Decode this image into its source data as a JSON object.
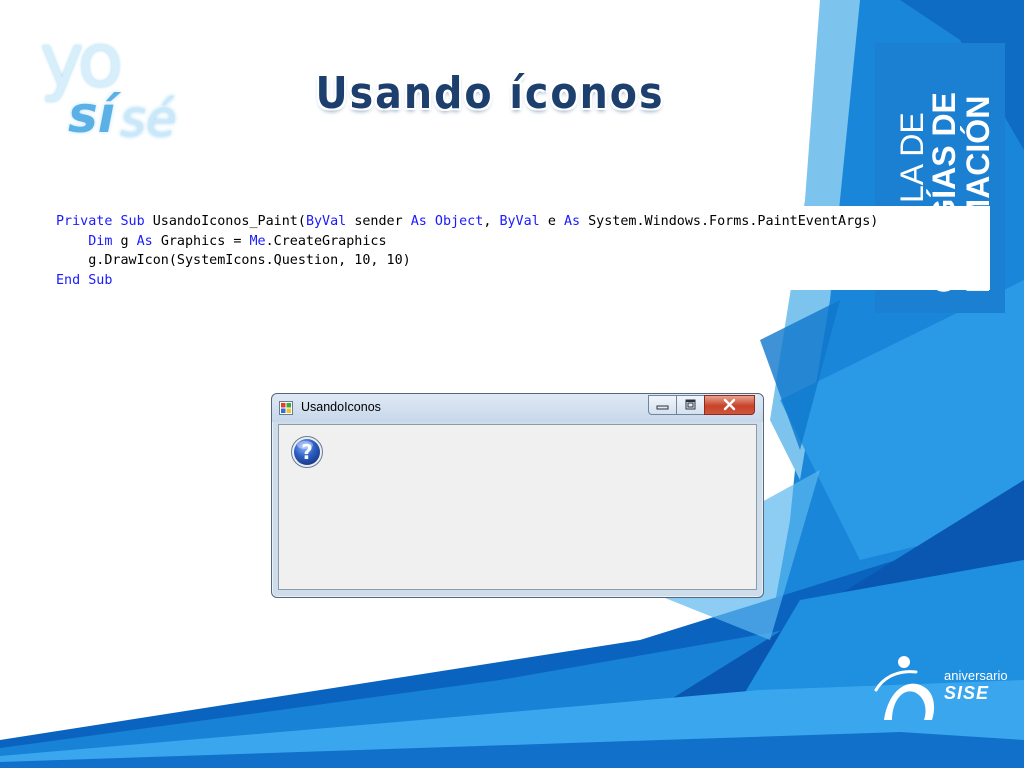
{
  "slide": {
    "title": "Usando íconos"
  },
  "logo": {
    "line1": "yo",
    "line2_a": "sí",
    "line2_b": "sé"
  },
  "side_panel": {
    "line1": "LA DE",
    "line2": "OLOGÍAS DE",
    "line3": "FORMACIÓN"
  },
  "code": {
    "lines": [
      [
        {
          "text": "Private Sub ",
          "kw": true
        },
        {
          "text": "UsandoIconos_Paint(",
          "kw": false
        },
        {
          "text": "ByVal ",
          "kw": true
        },
        {
          "text": "sender ",
          "kw": false
        },
        {
          "text": "As Object",
          "kw": true
        },
        {
          "text": ", ",
          "kw": false
        },
        {
          "text": "ByVal ",
          "kw": true
        },
        {
          "text": "e ",
          "kw": false
        },
        {
          "text": "As ",
          "kw": true
        },
        {
          "text": "System.Windows.Forms.PaintEventArgs)",
          "kw": false
        }
      ],
      [
        {
          "text": "    ",
          "kw": false
        },
        {
          "text": "Dim ",
          "kw": true
        },
        {
          "text": "g ",
          "kw": false
        },
        {
          "text": "As ",
          "kw": true
        },
        {
          "text": "Graphics = ",
          "kw": false
        },
        {
          "text": "Me",
          "kw": true
        },
        {
          "text": ".CreateGraphics",
          "kw": false
        }
      ],
      [
        {
          "text": "    g.DrawIcon(SystemIcons.Question, 10, 10)",
          "kw": false
        }
      ],
      [
        {
          "text": "End Sub",
          "kw": true
        }
      ]
    ]
  },
  "window": {
    "title": "UsandoIconos",
    "app_icon": "winforms-app-icon",
    "content_icon": "question-icon",
    "controls": {
      "minimize_icon": "minimize-icon",
      "maximize_icon": "maximize-icon",
      "close_icon": "close-icon"
    }
  },
  "anniversary": {
    "line1": "aniversario",
    "line2": "SISE"
  },
  "colors": {
    "title": "#1c3f6e",
    "keyword": "#1a1aff",
    "brand_blue": "#1b7fd2",
    "close_red": "#c7432a"
  }
}
